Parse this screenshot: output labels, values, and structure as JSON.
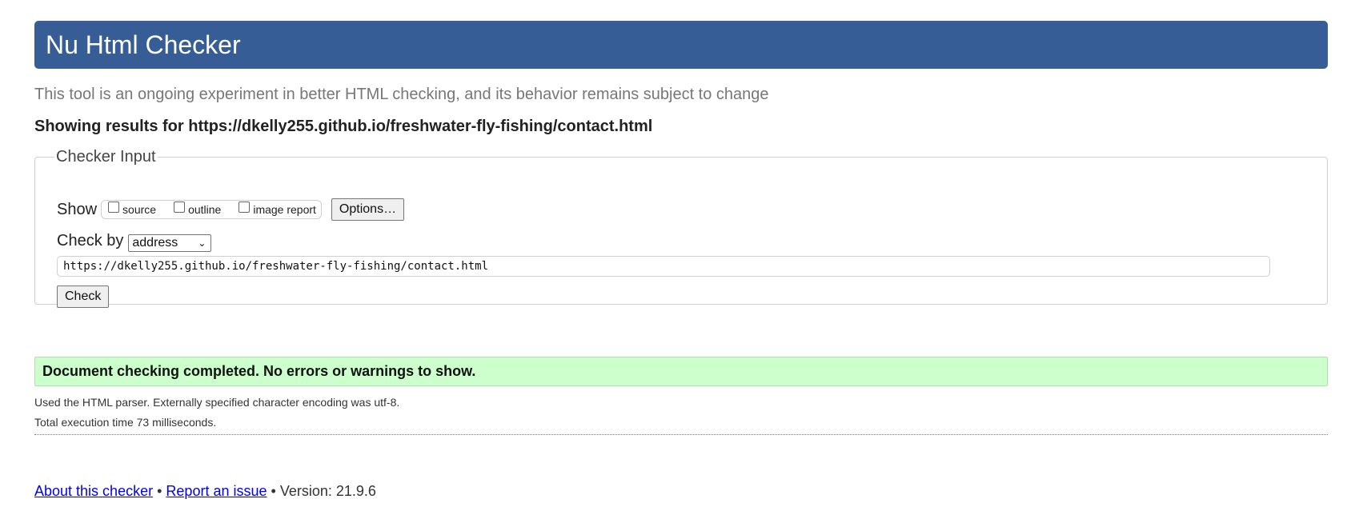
{
  "header": {
    "title": "Nu Html Checker"
  },
  "tagline": "This tool is an ongoing experiment in better HTML checking, and its behavior remains subject to change",
  "results_for": "Showing results for https://dkelly255.github.io/freshwater-fly-fishing/contact.html",
  "checker_input": {
    "legend": "Checker Input",
    "show_label": "Show",
    "show_options": [
      {
        "label": "source",
        "checked": false
      },
      {
        "label": "outline",
        "checked": false
      },
      {
        "label": "image report",
        "checked": false
      }
    ],
    "options_button": "Options…",
    "check_by_label": "Check by",
    "check_by_value": "address",
    "url_value": "https://dkelly255.github.io/freshwater-fly-fishing/contact.html",
    "check_button": "Check"
  },
  "status": {
    "message": "Document checking completed. No errors or warnings to show.",
    "color": "#ccffcc"
  },
  "details": {
    "parser_line": "Used the HTML parser. Externally specified character encoding was utf-8.",
    "time_line": "Total execution time 73 milliseconds."
  },
  "footer": {
    "about_link": "About this checker",
    "separator": "•",
    "report_link": "Report an issue",
    "version": "Version: 21.9.6"
  },
  "colors": {
    "header_bg": "#365d95",
    "link": "#0000ee"
  }
}
